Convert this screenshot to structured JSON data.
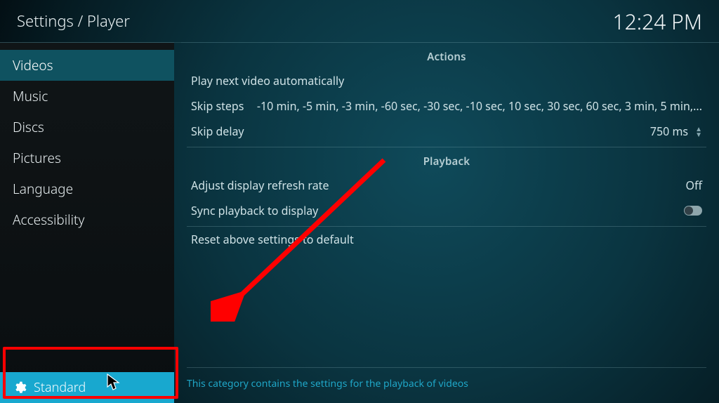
{
  "header": {
    "breadcrumb": "Settings / Player",
    "clock": "12:24 PM"
  },
  "sidebar": {
    "items": [
      {
        "label": "Videos",
        "selected": true
      },
      {
        "label": "Music",
        "selected": false
      },
      {
        "label": "Discs",
        "selected": false
      },
      {
        "label": "Pictures",
        "selected": false
      },
      {
        "label": "Language",
        "selected": false
      },
      {
        "label": "Accessibility",
        "selected": false
      }
    ],
    "level_label": "Standard"
  },
  "sections": {
    "actions": {
      "title": "Actions",
      "play_next": {
        "label": "Play next video automatically"
      },
      "skip_steps": {
        "label": "Skip steps",
        "value": "-10 min, -5 min, -3 min, -60 sec, -30 sec, -10 sec, 10 sec, 30 sec, 60 sec, 3 min, 5 min,..."
      },
      "skip_delay": {
        "label": "Skip delay",
        "value": "750 ms"
      }
    },
    "playback": {
      "title": "Playback",
      "refresh_rate": {
        "label": "Adjust display refresh rate",
        "value": "Off"
      },
      "sync_playback": {
        "label": "Sync playback to display",
        "toggle": false
      },
      "reset": {
        "label": "Reset above settings to default"
      }
    }
  },
  "footer": {
    "help_text": "This category contains the settings for the playback of videos"
  },
  "annotation": {
    "arrow_color": "#ff0000",
    "highlight_color": "#ff0000"
  }
}
